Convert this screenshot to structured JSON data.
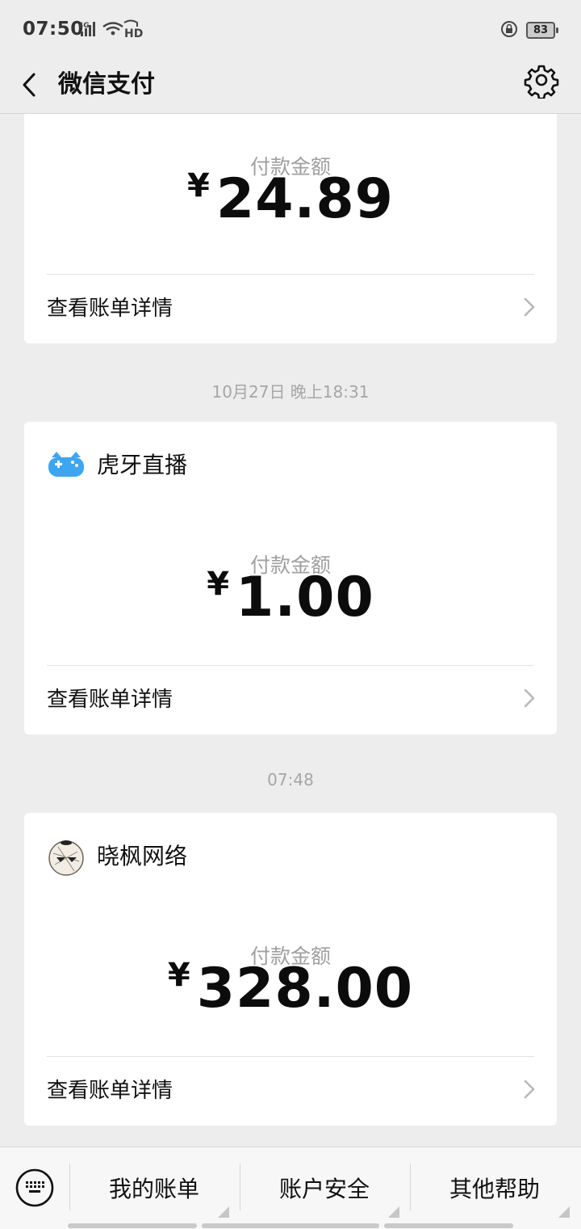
{
  "status_bar": {
    "time": "07:50",
    "network": "4G",
    "hd": "HD",
    "battery": "83"
  },
  "header": {
    "title": "微信支付"
  },
  "cards": [
    {
      "merchant": "",
      "amount_label": "付款金额",
      "currency": "¥",
      "amount": "24.89",
      "detail_label": "查看账单详情"
    },
    {
      "merchant": "虎牙直播",
      "amount_label": "付款金额",
      "currency": "¥",
      "amount": "1.00",
      "detail_label": "查看账单详情"
    },
    {
      "merchant": "晓枫网络",
      "amount_label": "付款金额",
      "currency": "¥",
      "amount": "328.00",
      "detail_label": "查看账单详情"
    }
  ],
  "timestamps": [
    "10月27日 晚上18:31",
    "07:48"
  ],
  "bottom_menu": [
    {
      "label": "我的账单"
    },
    {
      "label": "账户安全"
    },
    {
      "label": "其他帮助"
    }
  ],
  "colors": {
    "background": "#ededed",
    "card": "#ffffff",
    "muted_text": "#a0a0a0",
    "huya_blue": "#3ea6f0"
  },
  "icons": [
    "back-arrow-icon",
    "gear-icon",
    "huya-logo-icon",
    "xiaofeng-avatar-icon",
    "chevron-right-icon",
    "keyboard-icon"
  ]
}
